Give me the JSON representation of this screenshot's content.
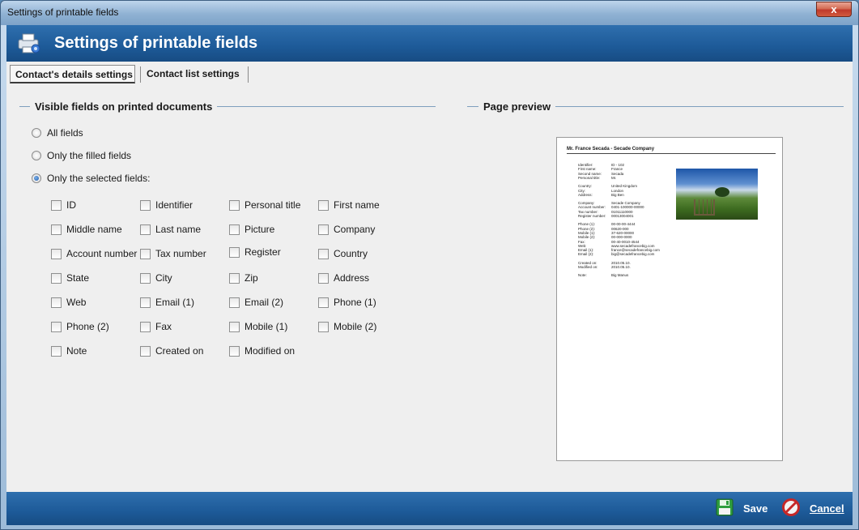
{
  "window": {
    "title": "Settings of printable fields",
    "close_glyph": "x"
  },
  "header": {
    "title": "Settings of printable fields",
    "icon": "printer-settings-icon"
  },
  "tabs": [
    {
      "label": "Contact's details settings",
      "active": true
    },
    {
      "label": "Contact list settings",
      "active": false
    }
  ],
  "visible_fields": {
    "title": "Visible fields on printed documents",
    "options": [
      {
        "label": "All fields",
        "checked": false
      },
      {
        "label": "Only the filled fields",
        "checked": false
      },
      {
        "label": "Only the selected fields:",
        "checked": true
      }
    ],
    "fields": [
      [
        "ID",
        "Identifier",
        "Personal title",
        "First name"
      ],
      [
        "Middle name",
        "Last name",
        "Picture",
        "Company"
      ],
      [
        "Account number",
        "Tax number",
        "Register",
        "Country"
      ],
      [
        "State",
        "City",
        "Zip",
        "Address"
      ],
      [
        "Web",
        "Email (1)",
        "Email (2)",
        "Phone (1)"
      ],
      [
        "Phone (2)",
        "Fax",
        "Mobile (1)",
        "Mobile (2)"
      ],
      [
        "Note",
        "Created on",
        "Modified on"
      ]
    ]
  },
  "preview": {
    "title": "Page preview",
    "doc_title": "Mr. France Secada - Secade Company",
    "rows": [
      [
        "Identifier:",
        "ID - 102"
      ],
      [
        "First name:",
        "France"
      ],
      [
        "Second name:",
        "Secada"
      ],
      [
        "Personal title:",
        "Mr."
      ],
      [
        "Country:",
        "United Kingdom"
      ],
      [
        "City:",
        "London"
      ],
      [
        "Address:",
        "Big Ben"
      ],
      [
        "Company:",
        "Secade Company"
      ],
      [
        "Account number:",
        "0401-100000-00000"
      ],
      [
        "Tax number:",
        "01011110000"
      ],
      [
        "Register number:",
        "00013004001"
      ],
      [
        "Phone (1):",
        "00-00-00-4444"
      ],
      [
        "Phone (2):",
        "00620-000"
      ],
      [
        "Mobile (1):",
        "37-620-00000"
      ],
      [
        "Mobile (2):",
        "00-000-0000"
      ],
      [
        "Fax:",
        "00-40-0010-4544"
      ],
      [
        "Web:",
        "www.secadefrancebig.com"
      ],
      [
        "Email (1):",
        "france@secadefrancebig.com"
      ],
      [
        "Email (2):",
        "big@secadefrancebig.com"
      ],
      [
        "Created on:",
        "2010.05.10."
      ],
      [
        "Modified on:",
        "2010.05.10."
      ],
      [
        "Note:",
        "Big Manus"
      ]
    ]
  },
  "footer": {
    "save_label": "Save",
    "cancel_label": "Cancel",
    "save_icon": "floppy-disk-icon",
    "cancel_icon": "cancel-icon"
  }
}
